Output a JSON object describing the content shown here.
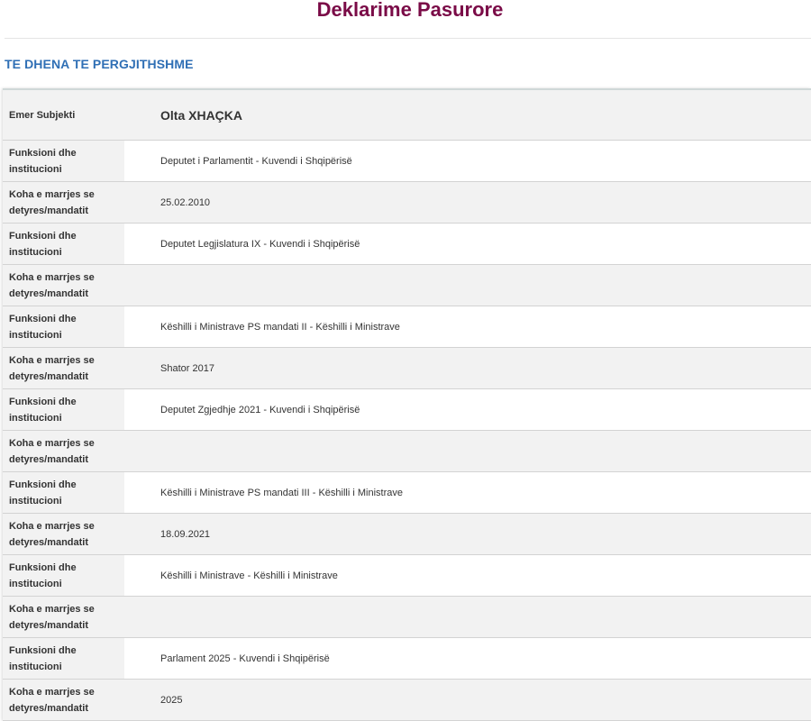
{
  "header": {
    "title": "Deklarime Pasurore",
    "section": "TE DHENA TE PERGJITHSHME"
  },
  "subject": {
    "label": "Emer Subjekti",
    "name": "Olta XHAÇKA"
  },
  "rows": [
    {
      "label": "Funksioni dhe institucioni",
      "value": "Deputet i Parlamentit - Kuvendi i Shqipërisë"
    },
    {
      "label": "Koha e marrjes se detyres/mandatit",
      "value": "25.02.2010"
    },
    {
      "label": "Funksioni dhe institucioni",
      "value": "Deputet Legjislatura IX - Kuvendi i Shqipërisë"
    },
    {
      "label": "Koha e marrjes se detyres/mandatit",
      "value": ""
    },
    {
      "label": "Funksioni dhe institucioni",
      "value": "Këshilli i Ministrave PS mandati II - Këshilli i Ministrave"
    },
    {
      "label": "Koha e marrjes se detyres/mandatit",
      "value": "Shator 2017"
    },
    {
      "label": "Funksioni dhe institucioni",
      "value": "Deputet Zgjedhje 2021 - Kuvendi i Shqipërisë"
    },
    {
      "label": "Koha e marrjes se detyres/mandatit",
      "value": ""
    },
    {
      "label": "Funksioni dhe institucioni",
      "value": "Këshilli i Ministrave PS mandati III - Këshilli i Ministrave"
    },
    {
      "label": "Koha e marrjes se detyres/mandatit",
      "value": "18.09.2021"
    },
    {
      "label": "Funksioni dhe institucioni",
      "value": "Këshilli i Ministrave - Këshilli i Ministrave"
    },
    {
      "label": "Koha e marrjes se detyres/mandatit",
      "value": ""
    },
    {
      "label": "Funksioni dhe institucioni",
      "value": "Parlament 2025 - Kuvendi i Shqipërisë"
    },
    {
      "label": "Koha e marrjes se detyres/mandatit",
      "value": "2025"
    }
  ],
  "colors": {
    "title": "#7a0b47",
    "section_heading": "#2f6fb5",
    "row_shade": "#f2f2f2"
  }
}
